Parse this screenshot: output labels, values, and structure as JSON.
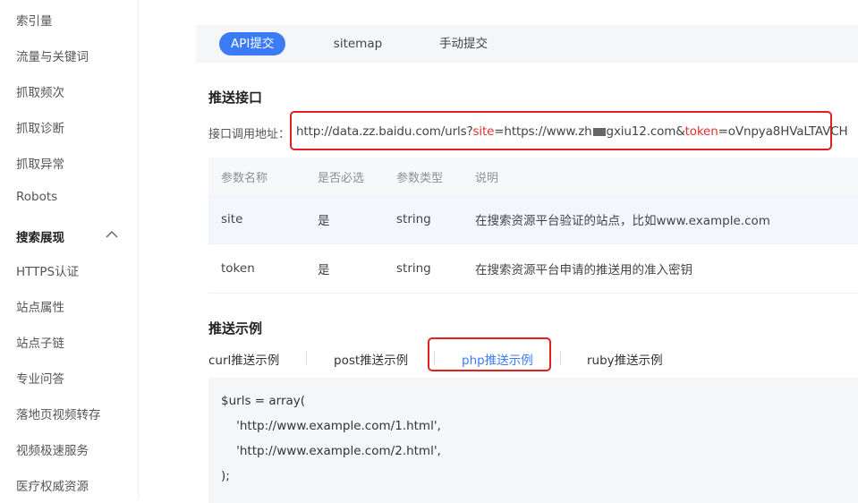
{
  "sidebar": {
    "items": [
      {
        "label": "索引量"
      },
      {
        "label": "流量与关键词"
      },
      {
        "label": "抓取频次"
      },
      {
        "label": "抓取诊断"
      },
      {
        "label": "抓取异常"
      },
      {
        "label": "Robots"
      },
      {
        "label": "搜索展现",
        "section": true,
        "expanded": true
      },
      {
        "label": "HTTPS认证"
      },
      {
        "label": "站点属性"
      },
      {
        "label": "站点子链"
      },
      {
        "label": "专业问答"
      },
      {
        "label": "落地页视频转存"
      },
      {
        "label": "视频极速服务"
      },
      {
        "label": "医疗权威资源"
      }
    ]
  },
  "tabs": [
    {
      "label": "API提交",
      "active": true
    },
    {
      "label": "sitemap"
    },
    {
      "label": "手动提交"
    }
  ],
  "endpoint": {
    "title": "推送接口",
    "label": "接口调用地址：",
    "url_prefix": "http://data.zz.baidu.com/urls?",
    "site_key": "site",
    "site_value_a": "=https://www.zh",
    "site_value_b": "gxiu12.com&",
    "token_key": "token",
    "token_value": "=oVnpya8HVaLTAVCH"
  },
  "params_table": {
    "headers": [
      "参数名称",
      "是否必选",
      "参数类型",
      "说明"
    ],
    "rows": [
      {
        "name": "site",
        "required": "是",
        "type": "string",
        "desc": "在搜索资源平台验证的站点，比如www.example.com"
      },
      {
        "name": "token",
        "required": "是",
        "type": "string",
        "desc": "在搜索资源平台申请的推送用的准入密钥"
      }
    ]
  },
  "examples": {
    "title": "推送示例",
    "tabs": [
      {
        "label": "curl推送示例"
      },
      {
        "label": "post推送示例"
      },
      {
        "label": "php推送示例",
        "active": true
      },
      {
        "label": "ruby推送示例"
      }
    ],
    "code_lines": [
      "$urls = array(",
      "    'http://www.example.com/1.html',",
      "    'http://www.example.com/2.html',",
      ");"
    ]
  },
  "colors": {
    "accent": "#3b7cf6",
    "highlight_red": "#e02020"
  }
}
